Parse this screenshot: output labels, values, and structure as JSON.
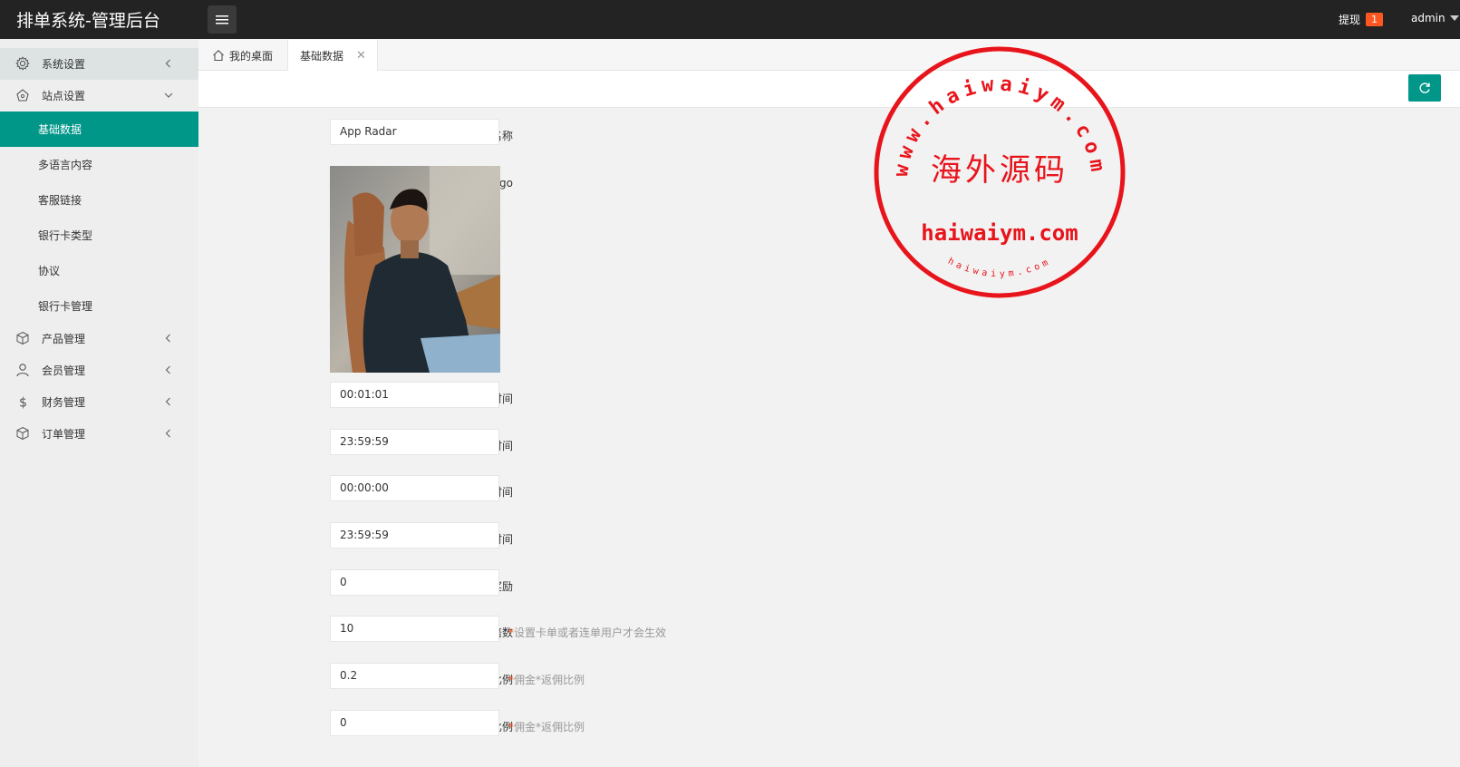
{
  "header": {
    "brand": "排单系统-管理后台",
    "withdraw_label": "提现",
    "withdraw_count": "1",
    "user": "admin"
  },
  "sidebar": {
    "items": [
      {
        "label": "系统设置",
        "icon": "gear-icon"
      },
      {
        "label": "站点设置",
        "icon": "site-icon"
      },
      {
        "label": "产品管理",
        "icon": "box-icon"
      },
      {
        "label": "会员管理",
        "icon": "user-icon"
      },
      {
        "label": "财务管理",
        "icon": "dollar-icon"
      },
      {
        "label": "订单管理",
        "icon": "order-icon"
      }
    ],
    "sub_items": [
      {
        "label": "基础数据"
      },
      {
        "label": "多语言内容"
      },
      {
        "label": "客服链接"
      },
      {
        "label": "银行卡类型"
      },
      {
        "label": "协议"
      },
      {
        "label": "银行卡管理"
      }
    ]
  },
  "tabs": [
    {
      "label": "我的桌面"
    },
    {
      "label": "基础数据"
    }
  ],
  "form": {
    "required_mark": "*",
    "fields": [
      {
        "label": "APP名称",
        "value": "App Radar"
      },
      {
        "label": "Logo"
      },
      {
        "label": "开盘时间",
        "value": "00:01:01"
      },
      {
        "label": "闭盘时间",
        "value": "23:59:59"
      },
      {
        "label": "提现-开始时间",
        "value": "00:00:00"
      },
      {
        "label": "提现-结束时间",
        "value": "23:59:59"
      },
      {
        "label": "注册奖励",
        "value": "0"
      },
      {
        "label": "返佣倍数",
        "value": "10",
        "hint": "设置卡单或者连单用户才会生效"
      },
      {
        "label": "一级返佣比例",
        "value": "0.2",
        "hint": "佣金*返佣比例"
      },
      {
        "label": "二级返佣比例",
        "value": "0",
        "hint": "佣金*返佣比例"
      }
    ]
  },
  "watermark": {
    "outer_text": "www.haiwaiym.com",
    "center_text": "海外源码",
    "domain_text": "haiwaiym.com",
    "bottom_text": "haiwaiym.com"
  },
  "colors": {
    "accent": "#009688",
    "header_bg": "#232323",
    "badge": "#ff5722",
    "stamp": "#e8141b"
  }
}
